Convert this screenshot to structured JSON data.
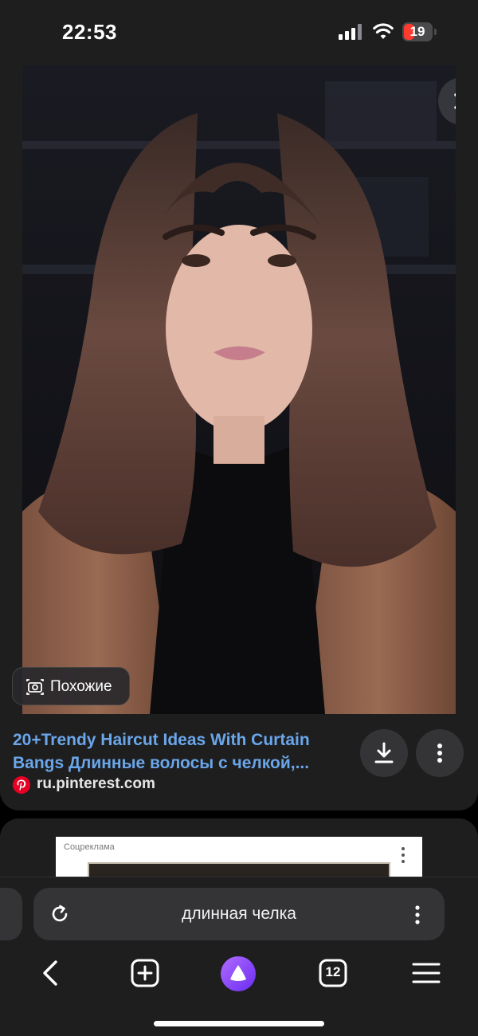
{
  "status_bar": {
    "time": "22:53",
    "battery_level": "19",
    "battery_color": "#ff3b30"
  },
  "result": {
    "image_description_icon": "woman-portrait-photo",
    "similar_label": "Похожие",
    "title": "20+Trendy Haircut Ideas With Curtain Bangs Длинные волосы с челкой,...",
    "source": "ru.pinterest.com",
    "title_color": "#6aa6ea"
  },
  "ad": {
    "label": "Соцреклама"
  },
  "search_bar": {
    "query": "длинная челка"
  },
  "nav": {
    "tabs_count": "12"
  },
  "icons": {
    "close": "close-icon",
    "camera": "camera-icon",
    "download": "download-icon",
    "more": "more-vertical-icon",
    "refresh": "refresh-icon",
    "back": "chevron-left-icon",
    "new_tab": "plus-square-icon",
    "alice": "alice-assistant-icon",
    "tabs": "tabs-icon",
    "menu": "hamburger-menu-icon"
  }
}
